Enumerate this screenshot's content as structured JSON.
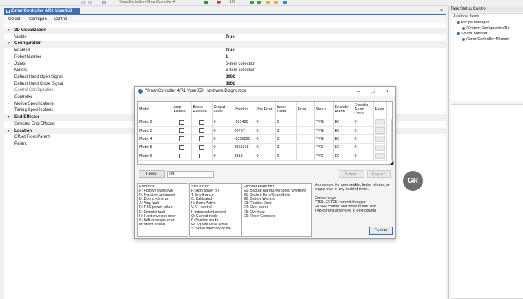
{
  "toolbar": {
    "path": "/SmartController 4/SmartController 4",
    "zoom": "100"
  },
  "document": {
    "tab_title": "/SmartController 4/R1 Viper850",
    "menus": [
      "Object",
      "Configure",
      "Control"
    ],
    "properties": [
      {
        "name": "3D Visualization",
        "value": "",
        "category": true,
        "expanded": true
      },
      {
        "name": "Visible",
        "value": "True",
        "bold": true
      },
      {
        "name": "Configuration",
        "value": "",
        "category": true,
        "expanded": true
      },
      {
        "name": "Enabled",
        "value": "True",
        "bold": true
      },
      {
        "name": "Robot Number",
        "value": "1",
        "bold": true
      },
      {
        "name": "Joints",
        "value": "6-item collection",
        "collapsed": true
      },
      {
        "name": "Motors",
        "value": "6-item collection",
        "collapsed": true
      },
      {
        "name": "Default Hand Open Signal",
        "value": "3002",
        "bold": true
      },
      {
        "name": "Default Hand Close Signal",
        "value": "3001",
        "bold": true
      },
      {
        "name": "Control Configuration",
        "value": "",
        "grey": true
      },
      {
        "name": "Controller",
        "value": ""
      },
      {
        "name": "Motion Specifications",
        "value": "",
        "collapsed": true
      },
      {
        "name": "Timing Specifications",
        "value": "",
        "collapsed": true
      },
      {
        "name": "End-Effector",
        "value": "",
        "category": true,
        "expanded": true
      },
      {
        "name": "Selected End-Effector",
        "value": ""
      },
      {
        "name": "Location",
        "value": "",
        "category": true,
        "expanded": true
      },
      {
        "name": "Offset From Parent",
        "value": ""
      },
      {
        "name": "Parent",
        "value": ""
      }
    ]
  },
  "right_panel": {
    "title": "Task Status Control",
    "available_label": "Available Items",
    "tree": [
      {
        "label": "Recipe Manager",
        "indent": 1,
        "color": "#4a8c3a"
      },
      {
        "label": "/System Configuration/Re",
        "indent": 2,
        "color": "#6a6a6a"
      },
      {
        "label": "SmartController",
        "indent": 1,
        "color": "#2f6db5"
      },
      {
        "label": "/SmartController 4/Smart",
        "indent": 2,
        "color": "#6a6a6a"
      }
    ]
  },
  "dialog": {
    "title": "'/SmartController 4/R1 Viper850' Hardware Diagnostics",
    "columns": [
      "Motor",
      "Amp Enable",
      "Brake Release",
      "Output Level",
      "Position",
      "Pos Error",
      "Index Delta",
      "Error",
      "Status",
      "Encoder Alarm",
      "Encoder Alarm Count",
      "Rese"
    ],
    "rows": [
      {
        "motor": "Motor 2",
        "output": "0",
        "position": "-161428",
        "pos_error": "0",
        "index_delta": "0",
        "error": "",
        "status": "TVG",
        "encoder_alarm": "E0",
        "alarm_count": "0"
      },
      {
        "motor": "Motor 3",
        "output": "0",
        "position": "20757",
        "pos_error": "0",
        "index_delta": "0",
        "error": "",
        "status": "TVG",
        "encoder_alarm": "E0",
        "alarm_count": "0"
      },
      {
        "motor": "Motor 4",
        "output": "0",
        "position": "-8358820",
        "pos_error": "0",
        "index_delta": "0",
        "error": "",
        "status": "TVG",
        "encoder_alarm": "E0",
        "alarm_count": "0"
      },
      {
        "motor": "Motor 5",
        "output": "0",
        "position": "8361138",
        "pos_error": "0",
        "index_delta": "0",
        "error": "",
        "status": "TVG",
        "encoder_alarm": "E0",
        "alarm_count": "0"
      },
      {
        "motor": "Motor 6",
        "output": "0",
        "position": "3318",
        "pos_error": "0",
        "index_delta": "0",
        "error": "",
        "status": "TVG",
        "encoder_alarm": "E0",
        "alarm_count": "0"
      }
    ],
    "power_label": "Power",
    "power_value": "Off",
    "output_minus_label": "Output -",
    "output_plus_label": "Output +",
    "error_bits": [
      "Error Bits:",
      "P: Positive overtravel",
      "N: Negative overtravel",
      "D: Duty cycle error",
      "A: Amp fault",
      "R: RSC power failure",
      "E: Encoder fault",
      "H: Hard envelope error",
      "S: Soft envelope error",
      "M: Motor stalled"
    ],
    "status_bits": [
      "Status Bits:",
      "P: High power on",
      "T: In tolerance",
      "C: Calibrated",
      "H: Home Active",
      "V: V+ control",
      "I: Independent control",
      "Q: Current mode",
      "P: Position mode",
      "W: Square wave active",
      "S: Servo trajectory active"
    ],
    "encoder_bits": [
      "Encoder Alarm Bits:",
      "E0: Backup Alarm/Overspeed Overflow",
      "E1: System Error/Count Error",
      "E2: Battery Warning",
      "E3: Position Error",
      "E4: Over-speed",
      "E5: Overheat",
      "E6: Reset Complete"
    ],
    "help": [
      "You can set the amp-enable, brake-release, or",
      "output level of any enabled motor.",
      "",
      "Control keys:",
      "CTRL-ENTER commit changes",
      "ENTER commit and move to next row",
      "TAB commit and move to next column"
    ],
    "cancel_label": "Cancel"
  },
  "avatar_initials": "GR"
}
